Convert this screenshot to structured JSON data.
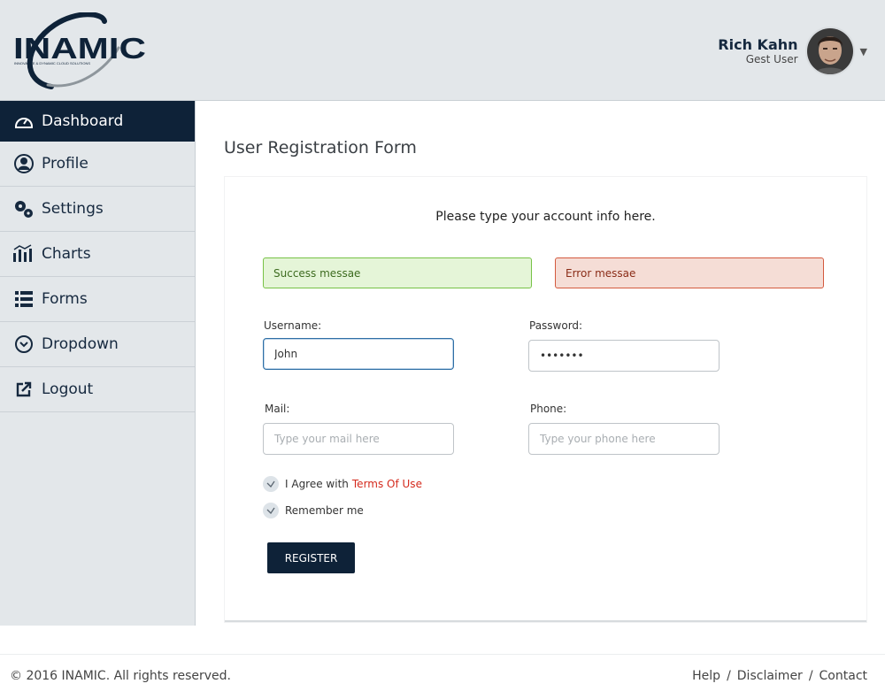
{
  "brand": {
    "logo_text": "INAMIC",
    "tagline": "INNOVATIVE & DYNAMIC CLOUD SOLUTIONS",
    "primary_color": "#0e2238"
  },
  "user": {
    "name": "Rich Kahn",
    "role": "Gest User",
    "menu_icon": "caret-down-icon"
  },
  "sidebar": {
    "items": [
      {
        "label": "Dashboard",
        "icon": "gauge-icon",
        "active": true
      },
      {
        "label": "Profile",
        "icon": "user-icon",
        "active": false
      },
      {
        "label": "Settings",
        "icon": "gears-icon",
        "active": false
      },
      {
        "label": "Charts",
        "icon": "bar-chart-icon",
        "active": false
      },
      {
        "label": "Forms",
        "icon": "list-icon",
        "active": false
      },
      {
        "label": "Dropdown",
        "icon": "chevron-circle-down-icon",
        "active": false
      },
      {
        "label": "Logout",
        "icon": "external-link-icon",
        "active": false
      }
    ]
  },
  "page": {
    "title": "User Registration Form"
  },
  "form": {
    "intro": "Please type your account info here.",
    "success_message": "Success messae",
    "error_message": "Error messae",
    "username": {
      "label": "Username:",
      "value": "John",
      "placeholder": ""
    },
    "password": {
      "label": "Password:",
      "value": "•••••••",
      "placeholder": ""
    },
    "mail": {
      "label": "Mail:",
      "value": "",
      "placeholder": "Type your mail here"
    },
    "phone": {
      "label": "Phone:",
      "value": "",
      "placeholder": "Type your phone here"
    },
    "agree": {
      "text": "I Agree with",
      "link": "Terms Of Use",
      "checked": true
    },
    "remember": {
      "text": "Remember me",
      "checked": true
    },
    "register_label": "REGISTER"
  },
  "colors": {
    "success_bg": "#e5f5d8",
    "success_border": "#77c246",
    "error_bg": "#f5ddd6",
    "error_border": "#d45a3e",
    "link": "#d42a1d"
  },
  "footer": {
    "copyright": "© 2016 INAMIC. All rights reserved.",
    "links": [
      "Help",
      "Disclaimer",
      "Contact"
    ],
    "separator": "/"
  }
}
